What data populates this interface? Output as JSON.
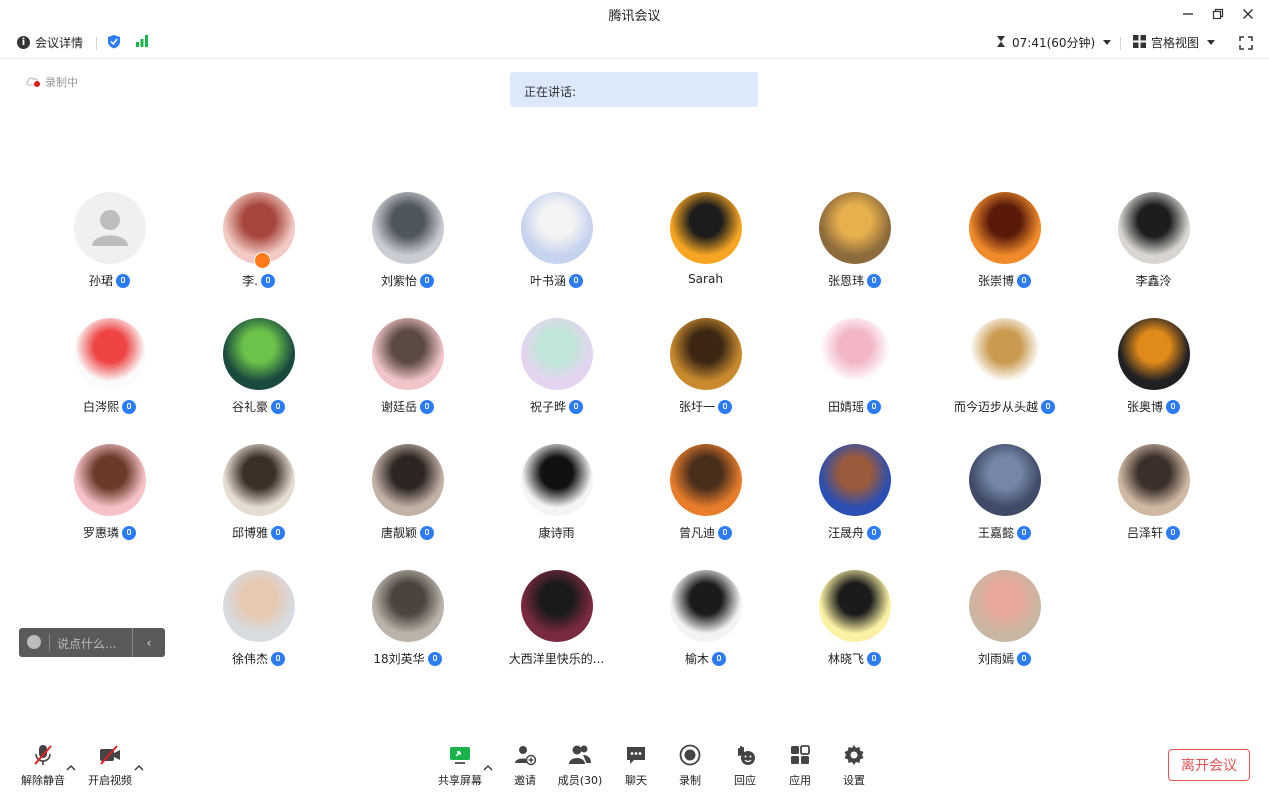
{
  "window": {
    "title": "腾讯会议",
    "minimize_icon": "minimize-icon",
    "restore_icon": "restore-icon",
    "close_icon": "close-icon"
  },
  "infobar": {
    "details_label": "会议详情",
    "timer": "07:41(60分钟)",
    "view_label": "宫格视图"
  },
  "recording_label": "录制中",
  "speaking_label": "正在讲话:",
  "participants": [
    {
      "name": "孙珺",
      "mic": true
    },
    {
      "name": "李.",
      "mic": true
    },
    {
      "name": "刘紫怡",
      "mic": true
    },
    {
      "name": "叶书涵",
      "mic": true
    },
    {
      "name": "Sarah",
      "mic": false
    },
    {
      "name": "张恩玮",
      "mic": true
    },
    {
      "name": "张崇博",
      "mic": true
    },
    {
      "name": "李鑫泠",
      "mic": false
    },
    {
      "name": "白涔熙",
      "mic": true
    },
    {
      "name": "谷礼豪",
      "mic": true
    },
    {
      "name": "谢廷岳",
      "mic": true
    },
    {
      "name": "祝子晔",
      "mic": true
    },
    {
      "name": "张圩一",
      "mic": true
    },
    {
      "name": "田婧瑶",
      "mic": true
    },
    {
      "name": "而今迈步从头越",
      "mic": true
    },
    {
      "name": "张奥博",
      "mic": true
    },
    {
      "name": "罗惠璘",
      "mic": true
    },
    {
      "name": "邱博雅",
      "mic": true
    },
    {
      "name": "唐靓颖",
      "mic": true
    },
    {
      "name": "康诗雨",
      "mic": false
    },
    {
      "name": "曾凡迪",
      "mic": true
    },
    {
      "name": "汪晟舟",
      "mic": true
    },
    {
      "name": "王嘉懿",
      "mic": true
    },
    {
      "name": "吕泽轩",
      "mic": true
    },
    {
      "name": "徐伟杰",
      "mic": true
    },
    {
      "name": "18刘英华",
      "mic": true
    },
    {
      "name": "大西洋里快乐的...",
      "mic": false
    },
    {
      "name": "榆木",
      "mic": true
    },
    {
      "name": "林晓飞",
      "mic": true
    },
    {
      "name": "刘雨嫣",
      "mic": true
    }
  ],
  "chat": {
    "placeholder": "说点什么..."
  },
  "toolbar": {
    "unmute": "解除静音",
    "start_video": "开启视频",
    "share_screen": "共享屏幕",
    "invite": "邀请",
    "members": "成员(30)",
    "chat": "聊天",
    "record": "录制",
    "reactions": "回应",
    "apps": "应用",
    "settings": "设置",
    "leave": "离开会议"
  },
  "colors": {
    "accent": "#2b7cf6",
    "leave": "#e45353",
    "speaking_bg": "#dbe9fb",
    "signal": "#19b34c"
  }
}
